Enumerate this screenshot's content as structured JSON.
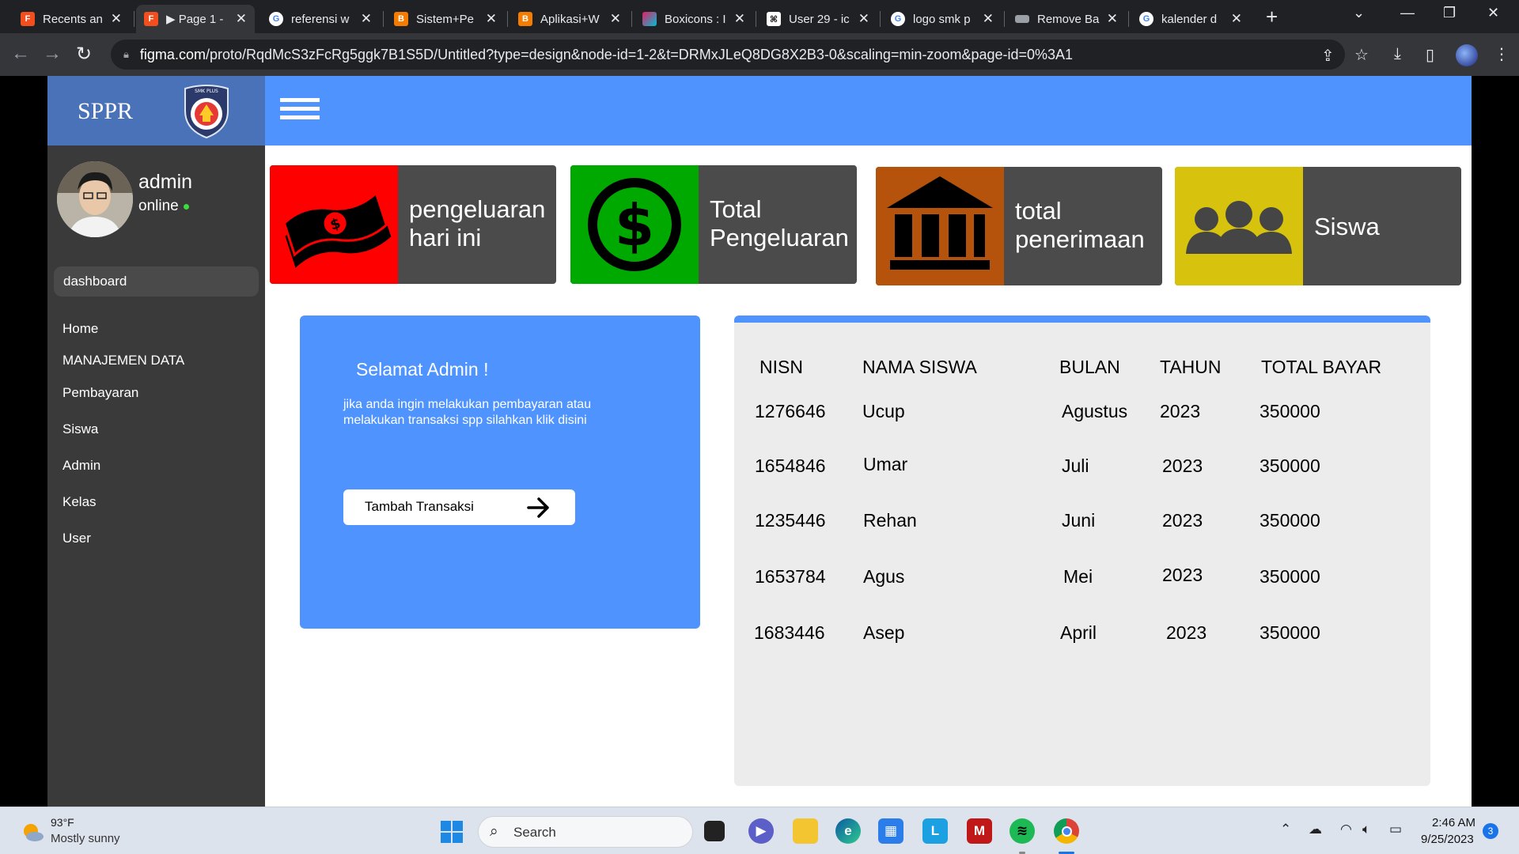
{
  "browser": {
    "tabs": [
      {
        "label": "Recents an",
        "favicon": "figma-icon",
        "color": "#f24e1e"
      },
      {
        "label": "▶ Page 1 -",
        "favicon": "figma-icon",
        "color": "#f24e1e"
      },
      {
        "label": "referensi w",
        "favicon": "google-icon",
        "color": "#4285f4"
      },
      {
        "label": "Sistem+Pe",
        "favicon": "blogger-icon",
        "color": "#f57c00"
      },
      {
        "label": "Aplikasi+W",
        "favicon": "blogger-icon",
        "color": "#f57c00"
      },
      {
        "label": "Boxicons : I",
        "favicon": "boxicons-icon",
        "color": "#e91e63"
      },
      {
        "label": "User 29 - ic",
        "favicon": "iconscout-icon",
        "color": "#ffffff"
      },
      {
        "label": "logo smk p",
        "favicon": "google-icon",
        "color": "#4285f4"
      },
      {
        "label": "Remove Ba",
        "favicon": "removebg-icon",
        "color": "#9aa0a6"
      },
      {
        "label": "kalender d",
        "favicon": "google-icon",
        "color": "#4285f4"
      }
    ],
    "url_host": "figma.com",
    "url_path": "/proto/RqdMcS3zFcRg5ggk7B1S5D/Untitled?type=design&node-id=1-2&t=DRMxJLeQ8DG8X2B3-0&scaling=min-zoom&page-id=0%3A1"
  },
  "app": {
    "brand_title": "SPPR",
    "logo_text": "SMK PLUS",
    "user": {
      "name": "admin",
      "status": "online"
    },
    "sidebar": {
      "active": "dashboard",
      "items": [
        "Home",
        "MANAJEMEN DATA",
        "Pembayaran",
        "Siswa",
        "Admin",
        "Kelas",
        "User"
      ]
    },
    "cards": [
      {
        "line1": "pengeluaran",
        "line2": "hari ini",
        "color": "#ff0000",
        "icon": "money-bill-icon"
      },
      {
        "line1": "Total",
        "line2": "Pengeluaran",
        "color": "#00a900",
        "icon": "dollar-circle-icon"
      },
      {
        "line1": "total",
        "line2": "penerimaan",
        "color": "#b5520c",
        "icon": "bank-icon"
      },
      {
        "line1": "Siswa",
        "line2": "",
        "color": "#d7c20d",
        "icon": "group-icon"
      }
    ],
    "welcome": {
      "title": "Selamat Admin !",
      "desc": "jika anda ingin melakukan pembayaran atau melakukan transaksi spp silahkan klik disini",
      "button": "Tambah Transaksi"
    },
    "table": {
      "headers": [
        "NISN",
        "NAMA SISWA",
        "BULAN",
        "TAHUN",
        "TOTAL BAYAR"
      ],
      "rows": [
        [
          "1276646",
          "Ucup",
          "Agustus",
          "2023",
          "350000"
        ],
        [
          "1654846",
          "Umar",
          "Juli",
          "2023",
          "350000"
        ],
        [
          "1235446",
          "Rehan",
          "Juni",
          "2023",
          "350000"
        ],
        [
          "1653784",
          "Agus",
          "Mei",
          "2023",
          "350000"
        ],
        [
          "1683446",
          "Asep",
          "April",
          "2023",
          "350000"
        ]
      ]
    }
  },
  "taskbar": {
    "weather_temp": "93°F",
    "weather_desc": "Mostly sunny",
    "search_placeholder": "Search",
    "time": "2:46 AM",
    "date": "9/25/2023",
    "notifications": "3"
  }
}
